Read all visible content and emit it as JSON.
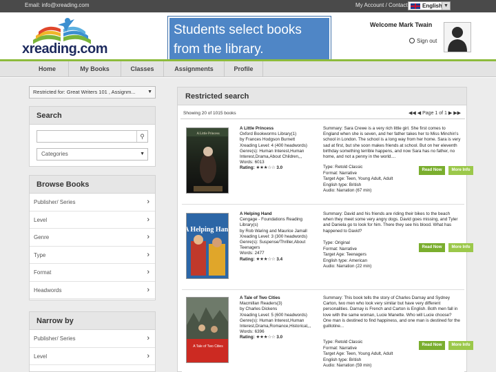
{
  "topbar": {
    "email": "Email: info@xreading.com",
    "account_links": "My Account / Contact /",
    "language": "English"
  },
  "header": {
    "logo_text": "xreading.com",
    "welcome": "Welcome Mark Twain",
    "sign_out": "Sign out"
  },
  "callout": {
    "line1": "Students select books",
    "line2": "from the library."
  },
  "nav": {
    "items": [
      "Home",
      "My Books",
      "Classes",
      "Assignments",
      "Profile"
    ]
  },
  "restrict_select": "Restricted for: Great Writers 101 , Assignm...",
  "search_panel": {
    "title": "Search",
    "categories_placeholder": "Categories"
  },
  "browse_panel": {
    "title": "Browse Books",
    "items": [
      "Publisher/ Series",
      "Level",
      "Genre",
      "Type",
      "Format",
      "Headwords"
    ]
  },
  "narrow_panel": {
    "title": "Narrow by",
    "items": [
      "Publisher/ Series",
      "Level"
    ]
  },
  "results": {
    "title": "Restricted search",
    "showing": "Showing 20 of 1015 books",
    "page_label": "Page 1 of 1",
    "read_now": "Read Now",
    "more_info": "More Info",
    "books": [
      {
        "title": "A Little Princess",
        "lines": [
          "Oxford Bookworms Library(1)",
          "by Frances Hodgson Burnett",
          "Xreading Level: 4 (400 headwords)",
          "Genre(s): Human Interest,Human",
          "Interest,Drama,About Children,,,",
          "Words: 6013"
        ],
        "rating_label": "Rating:",
        "rating": "3.0",
        "rating_value": 3.0,
        "summary": "Summary: Sara Crewe is a very rich little girl. She first comes to England when she is seven, and her father takes her to Miss Minchin's school in London. The school is a long way from her home. Sara is very sad at first, but she soon makes friends at school. But on her eleventh birthday something terrible happens, and now Sara has no father, no home, and not a penny in the world....",
        "type": "Type: Retold Classic",
        "format": "Format: Narrative",
        "target": "Target Age: Teen, Young Adult, Adult",
        "english": "English type: British",
        "audio": "Audio: Narration (67 min)",
        "cover_title": "A Little Princess",
        "cover_color": "#1c2a1c"
      },
      {
        "title": "A Helping Hand",
        "lines": [
          "Cengage - Foundations Reading Library(s)",
          "by Rob Waring and Maurice Jamall",
          "Xreading Level: 3 (300 headwords)",
          "Genre(s): Suspense/Thriller,About",
          "Teenagers",
          "Words: 2477"
        ],
        "rating_label": "Rating:",
        "rating": "3.4",
        "rating_value": 3.4,
        "summary": "Summary: David and his friends are riding their bikes to the beach when they meet some very angry dogs. David goes missing, and Tyler and Daniela go to look for him. There they see his blood. What has happened to David?",
        "type": "Type: Original",
        "format": "Format: Narrative",
        "target": "Target Age: Teenagers",
        "english": "English type: American",
        "audio": "Audio: Narration (22 min)",
        "cover_title": "A Helping Hand",
        "cover_color": "#2c66a6"
      },
      {
        "title": "A Tale of Two Cities",
        "lines": [
          "Macmillan Readers(3)",
          "by Charles Dickens",
          "Xreading Level: 5 (600 headwords)",
          "Genre(s): Human Interest,Human",
          "Interest,Drama,Romance,Historical,,,",
          "Words: 6396"
        ],
        "rating_label": "Rating:",
        "rating": "3.0",
        "rating_value": 3.0,
        "summary": "Summary: This book tells the story of Charles Darnay and Sydney Carton, two men who look very similar but have very different personalities. Darnay is French and Carton is English. Both men fall in love with the same woman, Lucie Manette. Who will Lucie choose? One man is destined to find happiness, and one man is destined for the guillotine...",
        "type": "Type: Retold Classic",
        "format": "Format: Narrative",
        "target": "Target Age: Teen, Young Adult, Adult",
        "english": "English type: British",
        "audio": "Audio: Narration (59 min)",
        "cover_title": "A Tale of Two Cities",
        "cover_color": "#cc2a22"
      }
    ]
  }
}
